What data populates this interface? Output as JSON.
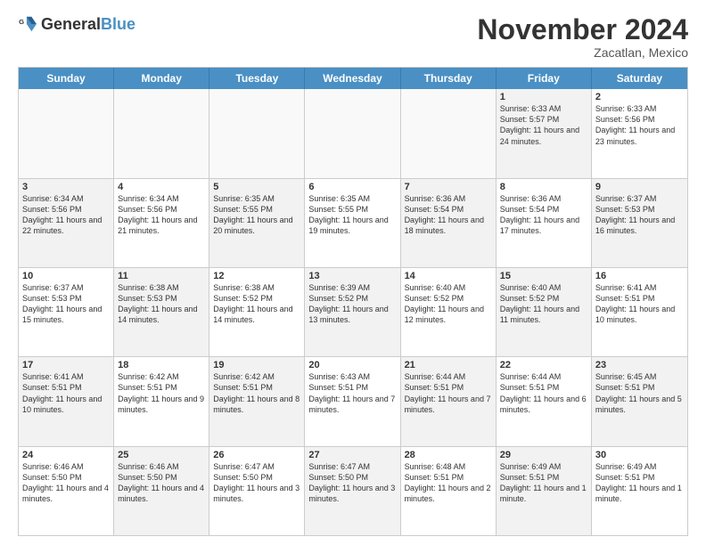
{
  "logo": {
    "general": "General",
    "blue": "Blue"
  },
  "title": "November 2024",
  "location": "Zacatlan, Mexico",
  "days": [
    "Sunday",
    "Monday",
    "Tuesday",
    "Wednesday",
    "Thursday",
    "Friday",
    "Saturday"
  ],
  "rows": [
    [
      {
        "day": "",
        "info": "",
        "empty": true
      },
      {
        "day": "",
        "info": "",
        "empty": true
      },
      {
        "day": "",
        "info": "",
        "empty": true
      },
      {
        "day": "",
        "info": "",
        "empty": true
      },
      {
        "day": "",
        "info": "",
        "empty": true
      },
      {
        "day": "1",
        "info": "Sunrise: 6:33 AM\nSunset: 5:57 PM\nDaylight: 11 hours and 24 minutes.",
        "shaded": true
      },
      {
        "day": "2",
        "info": "Sunrise: 6:33 AM\nSunset: 5:56 PM\nDaylight: 11 hours and 23 minutes.",
        "shaded": false
      }
    ],
    [
      {
        "day": "3",
        "info": "Sunrise: 6:34 AM\nSunset: 5:56 PM\nDaylight: 11 hours and 22 minutes.",
        "shaded": true
      },
      {
        "day": "4",
        "info": "Sunrise: 6:34 AM\nSunset: 5:56 PM\nDaylight: 11 hours and 21 minutes.",
        "shaded": false
      },
      {
        "day": "5",
        "info": "Sunrise: 6:35 AM\nSunset: 5:55 PM\nDaylight: 11 hours and 20 minutes.",
        "shaded": true
      },
      {
        "day": "6",
        "info": "Sunrise: 6:35 AM\nSunset: 5:55 PM\nDaylight: 11 hours and 19 minutes.",
        "shaded": false
      },
      {
        "day": "7",
        "info": "Sunrise: 6:36 AM\nSunset: 5:54 PM\nDaylight: 11 hours and 18 minutes.",
        "shaded": true
      },
      {
        "day": "8",
        "info": "Sunrise: 6:36 AM\nSunset: 5:54 PM\nDaylight: 11 hours and 17 minutes.",
        "shaded": false
      },
      {
        "day": "9",
        "info": "Sunrise: 6:37 AM\nSunset: 5:53 PM\nDaylight: 11 hours and 16 minutes.",
        "shaded": true
      }
    ],
    [
      {
        "day": "10",
        "info": "Sunrise: 6:37 AM\nSunset: 5:53 PM\nDaylight: 11 hours and 15 minutes.",
        "shaded": false
      },
      {
        "day": "11",
        "info": "Sunrise: 6:38 AM\nSunset: 5:53 PM\nDaylight: 11 hours and 14 minutes.",
        "shaded": true
      },
      {
        "day": "12",
        "info": "Sunrise: 6:38 AM\nSunset: 5:52 PM\nDaylight: 11 hours and 14 minutes.",
        "shaded": false
      },
      {
        "day": "13",
        "info": "Sunrise: 6:39 AM\nSunset: 5:52 PM\nDaylight: 11 hours and 13 minutes.",
        "shaded": true
      },
      {
        "day": "14",
        "info": "Sunrise: 6:40 AM\nSunset: 5:52 PM\nDaylight: 11 hours and 12 minutes.",
        "shaded": false
      },
      {
        "day": "15",
        "info": "Sunrise: 6:40 AM\nSunset: 5:52 PM\nDaylight: 11 hours and 11 minutes.",
        "shaded": true
      },
      {
        "day": "16",
        "info": "Sunrise: 6:41 AM\nSunset: 5:51 PM\nDaylight: 11 hours and 10 minutes.",
        "shaded": false
      }
    ],
    [
      {
        "day": "17",
        "info": "Sunrise: 6:41 AM\nSunset: 5:51 PM\nDaylight: 11 hours and 10 minutes.",
        "shaded": true
      },
      {
        "day": "18",
        "info": "Sunrise: 6:42 AM\nSunset: 5:51 PM\nDaylight: 11 hours and 9 minutes.",
        "shaded": false
      },
      {
        "day": "19",
        "info": "Sunrise: 6:42 AM\nSunset: 5:51 PM\nDaylight: 11 hours and 8 minutes.",
        "shaded": true
      },
      {
        "day": "20",
        "info": "Sunrise: 6:43 AM\nSunset: 5:51 PM\nDaylight: 11 hours and 7 minutes.",
        "shaded": false
      },
      {
        "day": "21",
        "info": "Sunrise: 6:44 AM\nSunset: 5:51 PM\nDaylight: 11 hours and 7 minutes.",
        "shaded": true
      },
      {
        "day": "22",
        "info": "Sunrise: 6:44 AM\nSunset: 5:51 PM\nDaylight: 11 hours and 6 minutes.",
        "shaded": false
      },
      {
        "day": "23",
        "info": "Sunrise: 6:45 AM\nSunset: 5:51 PM\nDaylight: 11 hours and 5 minutes.",
        "shaded": true
      }
    ],
    [
      {
        "day": "24",
        "info": "Sunrise: 6:46 AM\nSunset: 5:50 PM\nDaylight: 11 hours and 4 minutes.",
        "shaded": false
      },
      {
        "day": "25",
        "info": "Sunrise: 6:46 AM\nSunset: 5:50 PM\nDaylight: 11 hours and 4 minutes.",
        "shaded": true
      },
      {
        "day": "26",
        "info": "Sunrise: 6:47 AM\nSunset: 5:50 PM\nDaylight: 11 hours and 3 minutes.",
        "shaded": false
      },
      {
        "day": "27",
        "info": "Sunrise: 6:47 AM\nSunset: 5:50 PM\nDaylight: 11 hours and 3 minutes.",
        "shaded": true
      },
      {
        "day": "28",
        "info": "Sunrise: 6:48 AM\nSunset: 5:51 PM\nDaylight: 11 hours and 2 minutes.",
        "shaded": false
      },
      {
        "day": "29",
        "info": "Sunrise: 6:49 AM\nSunset: 5:51 PM\nDaylight: 11 hours and 1 minute.",
        "shaded": true
      },
      {
        "day": "30",
        "info": "Sunrise: 6:49 AM\nSunset: 5:51 PM\nDaylight: 11 hours and 1 minute.",
        "shaded": false
      }
    ]
  ]
}
